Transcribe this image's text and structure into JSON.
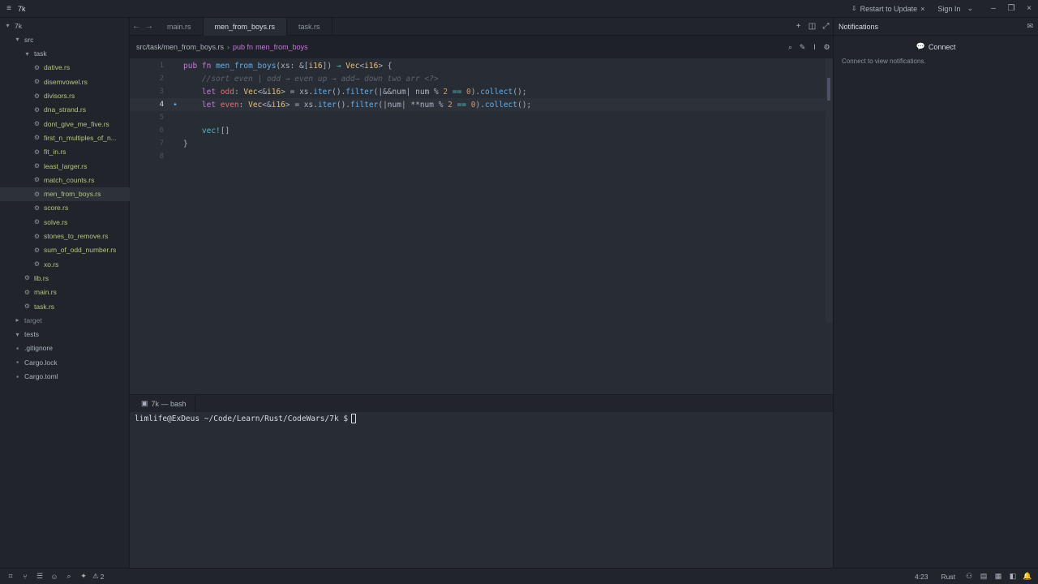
{
  "titlebar": {
    "project": "7k",
    "restart_label": "Restart to Update",
    "signin_label": "Sign In"
  },
  "sidebar": {
    "items": [
      {
        "label": "7k",
        "kind": "root"
      },
      {
        "label": "src",
        "kind": "dir"
      },
      {
        "label": "task",
        "kind": "dir"
      },
      {
        "label": "dative.rs",
        "kind": "rs"
      },
      {
        "label": "disemvowel.rs",
        "kind": "rs"
      },
      {
        "label": "divisors.rs",
        "kind": "rs"
      },
      {
        "label": "dna_strand.rs",
        "kind": "rs"
      },
      {
        "label": "dont_give_me_five.rs",
        "kind": "rs"
      },
      {
        "label": "first_n_multiples_of_n...",
        "kind": "rs"
      },
      {
        "label": "fit_in.rs",
        "kind": "rs"
      },
      {
        "label": "least_larger.rs",
        "kind": "rs"
      },
      {
        "label": "match_counts.rs",
        "kind": "rs"
      },
      {
        "label": "men_from_boys.rs",
        "kind": "rs"
      },
      {
        "label": "score.rs",
        "kind": "rs"
      },
      {
        "label": "solve.rs",
        "kind": "rs"
      },
      {
        "label": "stones_to_remove.rs",
        "kind": "rs"
      },
      {
        "label": "sum_of_odd_number.rs",
        "kind": "rs"
      },
      {
        "label": "xo.rs",
        "kind": "rs"
      },
      {
        "label": "lib.rs",
        "kind": "rs"
      },
      {
        "label": "main.rs",
        "kind": "rs"
      },
      {
        "label": "task.rs",
        "kind": "rs"
      },
      {
        "label": "target",
        "kind": "dir-dim"
      },
      {
        "label": "tests",
        "kind": "dir"
      },
      {
        "label": ".gitignore",
        "kind": "file"
      },
      {
        "label": "Cargo.lock",
        "kind": "file"
      },
      {
        "label": "Cargo.toml",
        "kind": "file"
      }
    ]
  },
  "tabs": [
    {
      "label": "main.rs"
    },
    {
      "label": "men_from_boys.rs"
    },
    {
      "label": "task.rs"
    }
  ],
  "breadcrumb": {
    "path": "src/task/men_from_boys.rs",
    "sep": "›",
    "symbol_kw": "pub fn",
    "symbol_name": "men_from_boys"
  },
  "editor": {
    "line_numbers": [
      "1",
      "2",
      "3",
      "4",
      "5",
      "6",
      "7",
      "8"
    ],
    "current_line": "4",
    "lines": [
      [
        {
          "t": "pub ",
          "c": "kw"
        },
        {
          "t": "fn ",
          "c": "kw"
        },
        {
          "t": "men_from_boys",
          "c": "fn"
        },
        {
          "t": "(xs: &[",
          "c": ""
        },
        {
          "t": "i16",
          "c": "ty"
        },
        {
          "t": "]) ",
          "c": ""
        },
        {
          "t": "→ ",
          "c": "op"
        },
        {
          "t": "Vec",
          "c": "ty"
        },
        {
          "t": "<",
          "c": ""
        },
        {
          "t": "i16",
          "c": "ty"
        },
        {
          "t": "> {",
          "c": ""
        }
      ],
      [
        {
          "t": "    //sort even | odd → even up → add→ down two arr <?>",
          "c": "cm"
        }
      ],
      [
        {
          "t": "    let ",
          "c": "kw"
        },
        {
          "t": "odd",
          "c": "var"
        },
        {
          "t": ": ",
          "c": ""
        },
        {
          "t": "Vec",
          "c": "ty"
        },
        {
          "t": "<&",
          "c": ""
        },
        {
          "t": "i16",
          "c": "ty"
        },
        {
          "t": "> = xs.",
          "c": ""
        },
        {
          "t": "iter",
          "c": "fn"
        },
        {
          "t": "().",
          "c": ""
        },
        {
          "t": "filter",
          "c": "fn"
        },
        {
          "t": "(|&&num| num % ",
          "c": ""
        },
        {
          "t": "2",
          "c": "num"
        },
        {
          "t": " == ",
          "c": "op"
        },
        {
          "t": "0",
          "c": "num"
        },
        {
          "t": ").",
          "c": ""
        },
        {
          "t": "collect",
          "c": "fn"
        },
        {
          "t": "();",
          "c": ""
        }
      ],
      [
        {
          "t": "    let ",
          "c": "kw"
        },
        {
          "t": "even",
          "c": "var"
        },
        {
          "t": ": ",
          "c": ""
        },
        {
          "t": "Vec",
          "c": "ty"
        },
        {
          "t": "<&",
          "c": ""
        },
        {
          "t": "i16",
          "c": "ty"
        },
        {
          "t": "> = xs.",
          "c": ""
        },
        {
          "t": "iter",
          "c": "fn"
        },
        {
          "t": "().",
          "c": ""
        },
        {
          "t": "filter",
          "c": "fn"
        },
        {
          "t": "(|num| **num % ",
          "c": ""
        },
        {
          "t": "2",
          "c": "num"
        },
        {
          "t": " == ",
          "c": "op"
        },
        {
          "t": "0",
          "c": "num"
        },
        {
          "t": ").",
          "c": ""
        },
        {
          "t": "collect",
          "c": "fn"
        },
        {
          "t": "();",
          "c": ""
        }
      ],
      [
        {
          "t": "",
          "c": ""
        }
      ],
      [
        {
          "t": "    ",
          "c": ""
        },
        {
          "t": "vec!",
          "c": "mac"
        },
        {
          "t": "[]",
          "c": ""
        }
      ],
      [
        {
          "t": "}",
          "c": ""
        }
      ],
      [
        {
          "t": "",
          "c": ""
        }
      ]
    ]
  },
  "terminal": {
    "tab_label": "7k — bash",
    "prompt": "limlife@ExDeus ~/Code/Learn/Rust/CodeWars/7k $"
  },
  "notifications": {
    "title": "Notifications",
    "connect_label": "Connect",
    "message": "Connect to view notifications."
  },
  "statusbar": {
    "warnings": "2",
    "position": "4:23",
    "language": "Rust"
  },
  "colors": {
    "background": "#1e2127",
    "panel": "#21252b",
    "editor": "#282c34",
    "keyword": "#c678dd",
    "function": "#61afef",
    "type": "#e5c07b",
    "file_rs": "#b5c47f"
  }
}
